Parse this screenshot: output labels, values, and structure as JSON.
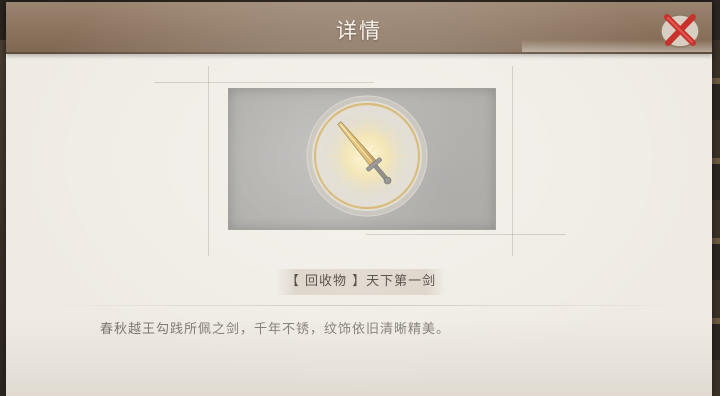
{
  "header": {
    "title": "详情"
  },
  "close_button": {
    "icon": "close-x-icon"
  },
  "item": {
    "category": "【 回收物 】",
    "name": "天下第一剑",
    "image_icon": "golden-sword-icon",
    "description": "春秋越王勾践所佩之剑，千年不锈，纹饰依旧清晰精美。"
  },
  "colors": {
    "header_bg": "#8a725d",
    "panel_bg": "#efebe4",
    "close_red": "#c8322d",
    "emblem_ring": "#c9a34a",
    "art_bg": "#a19e9a"
  }
}
